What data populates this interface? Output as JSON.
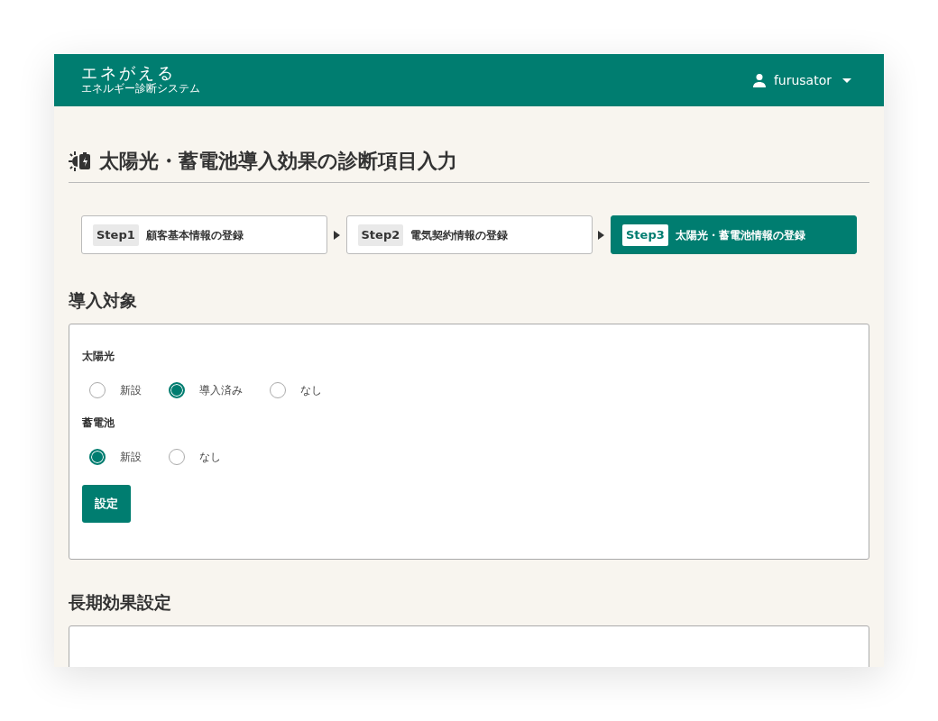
{
  "app": {
    "logo": "エネがえる",
    "subtitle": "エネルギー診断システム",
    "user": "furusator"
  },
  "page_title": "太陽光・蓄電池導入効果の診断項目入力",
  "steps": [
    {
      "number": "Step1",
      "label": "顧客基本情報の登録",
      "selected": false
    },
    {
      "number": "Step2",
      "label": "電気契約情報の登録",
      "selected": false
    },
    {
      "number": "Step3",
      "label": "太陽光・蓄電池情報の登録",
      "selected": true
    }
  ],
  "sections": [
    {
      "title": "導入対象",
      "groups": [
        {
          "label": "太陽光",
          "options": [
            {
              "label": "新設",
              "selected": false
            },
            {
              "label": "導入済み",
              "selected": true
            },
            {
              "label": "なし",
              "selected": false
            }
          ]
        },
        {
          "label": "蓄電池",
          "options": [
            {
              "label": "新設",
              "selected": true
            },
            {
              "label": "なし",
              "selected": false
            }
          ]
        }
      ],
      "button": "設定"
    },
    {
      "title": "長期効果設定"
    }
  ]
}
